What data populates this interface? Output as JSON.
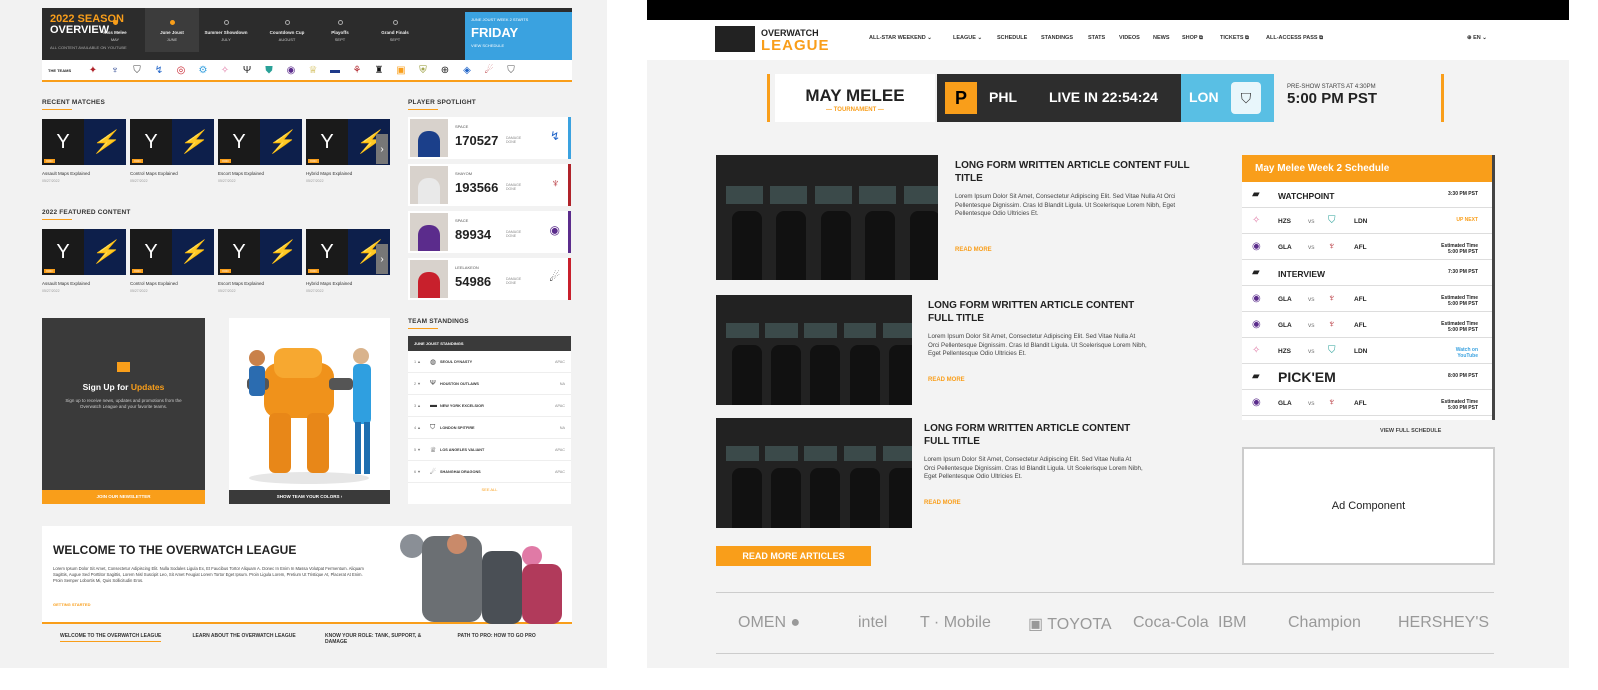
{
  "season": {
    "title_line1": "2022 SEASON",
    "title_line2": "OVERVIEW",
    "subline": "ALL CONTENT AVAILABLE ON YOUTUBE",
    "steps": [
      {
        "name": "Kiss Melee",
        "sub": "MAY"
      },
      {
        "name": "June Joust",
        "sub": "JUNE"
      },
      {
        "name": "Summer Showdown",
        "sub": "JULY"
      },
      {
        "name": "Countdown Cup",
        "sub": "AUGUST"
      },
      {
        "name": "Playoffs",
        "sub": "SEPT"
      },
      {
        "name": "Grand Finals",
        "sub": "SEPT"
      }
    ],
    "next": {
      "label": "JUNE JOUST WEEK 2 STARTS",
      "day": "FRIDAY",
      "link": "VIEW SCHEDULE"
    }
  },
  "teams_label": "THE TEAMS",
  "teams": [
    "✦",
    "♆",
    "⛉",
    "↯",
    "◎",
    "⚙",
    "✧",
    "Ψ",
    "⛊",
    "◉",
    "♕",
    "▬",
    "⚘",
    "♜",
    "▣",
    "⛨",
    "⊕",
    "◈",
    "☄",
    "⛉"
  ],
  "recent": {
    "heading": "RECENT MATCHES",
    "items": [
      {
        "title": "Assault Maps Explained",
        "meta": "05/27/2022"
      },
      {
        "title": "Control Maps Explained",
        "meta": "05/27/2022"
      },
      {
        "title": "Escort Maps Explained",
        "meta": "05/27/2022"
      },
      {
        "title": "Hybrid Maps Explained",
        "meta": "05/27/2022"
      }
    ]
  },
  "featured": {
    "heading": "2022 FEATURED CONTENT",
    "items": [
      {
        "title": "Assault Maps Explained",
        "meta": "05/27/2022"
      },
      {
        "title": "Control Maps Explained",
        "meta": "05/27/2022"
      },
      {
        "title": "Escort Maps Explained",
        "meta": "05/27/2022"
      },
      {
        "title": "Hybrid Maps Explained",
        "meta": "05/27/2022"
      }
    ]
  },
  "spotlight": {
    "heading": "PLAYER SPOTLIGHT",
    "players": [
      {
        "name": "SPACE",
        "score": "170527",
        "label": "DAMAGE DONE",
        "logo": "↯",
        "color": "#1e63c8",
        "shirt": "#1b3f8a",
        "bar": "#3aa2e0"
      },
      {
        "name": "SHAYOM",
        "score": "193566",
        "label": "DAMAGE DONE",
        "logo": "♆",
        "color": "#b0232a",
        "shirt": "#e9e9e9",
        "bar": "#b0232a"
      },
      {
        "name": "SPACE",
        "score": "89934",
        "label": "DAMAGE DONE",
        "logo": "◉",
        "color": "#5b2c8c",
        "shirt": "#5b2c8c",
        "bar": "#5b2c8c"
      },
      {
        "name": "LEELAKEON",
        "score": "54986",
        "label": "DAMAGE DONE",
        "logo": "☄",
        "color": "#222222",
        "shirt": "#c8202c",
        "bar": "#c8202c"
      }
    ]
  },
  "signup": {
    "title_a": "Sign Up for ",
    "title_b": "Updates",
    "text": "Sign up to receive news, updates and promotions from the Overwatch League and your favorite teams.",
    "button": "JOIN OUR NEWSLETTER"
  },
  "hero": {
    "button": "SHOW TEAM YOUR COLORS  ›"
  },
  "standings": {
    "heading": "TEAM STANDINGS",
    "subheading": "JUNE JOUST STANDINGS",
    "rows": [
      {
        "rank": "1 ▲",
        "icon": "◍",
        "team": "SEOUL DYNASTY",
        "conf": "APAC"
      },
      {
        "rank": "2 ▼",
        "icon": "Ψ",
        "team": "HOUSTON OUTLAWS",
        "conf": "NA"
      },
      {
        "rank": "3 ▲",
        "icon": "▬",
        "team": "NEW YORK EXCELSIOR",
        "conf": "APAC"
      },
      {
        "rank": "4 ▲",
        "icon": "⛉",
        "team": "LONDON SPITFIRE",
        "conf": "NA"
      },
      {
        "rank": "5 ▼",
        "icon": "♕",
        "team": "LOS ANGELES VALIANT",
        "conf": "APAC"
      },
      {
        "rank": "6 ▼",
        "icon": "☄",
        "team": "SHANGHAI DRAGONS",
        "conf": "APAC"
      }
    ],
    "see_all": "SEE ALL"
  },
  "welcome": {
    "title": "WELCOME TO THE OVERWATCH LEAGUE",
    "text": "Lorem Ipsum Dolor Sit Amet, Consectetur Adipiscing Elit. Nulla Sodales Ligula Ex, Et Faucibus Tortor Aliquam A. Donec In Enim In Massa Volutpat Fermentum. Aliquam Sagittis, Augue Sed Porttitor Sagittis, Lorem Nisl Suscipit Leo, Sit Amet Feugiat Lorem Tortor Eget Ipsum. Proin Ligula Lorem, Pretium Ut Tristique At, Placerat At Enim. Proin Semper Lobortis Mi, Quis Sollicitudin Eros.",
    "link": "GETTING STARTED",
    "links": [
      "WELCOME TO THE OVERWATCH LEAGUE",
      "LEARN ABOUT THE OVERWATCH LEAGUE",
      "KNOW YOUR ROLE: TANK, SUPPORT, & DAMAGE",
      "PATH TO PRO: HOW TO GO PRO"
    ]
  },
  "nav": {
    "logo_top": "OVERWATCH",
    "logo_bottom": "LEAGUE",
    "items": [
      "ALL-STAR WEEKEND ⌄",
      "LEAGUE ⌄",
      "SCHEDULE",
      "STANDINGS",
      "STATS",
      "VIDEOS",
      "NEWS",
      "SHOP ⧉",
      "TICKETS ⧉",
      "ALL-ACCESS PASS ⧉"
    ],
    "lang": "⊕ EN ⌄"
  },
  "ticker": {
    "event": "MAY MELEE",
    "event_sub": "— TOURNAMENT —",
    "team1": "PHL",
    "live": "LIVE IN 22:54:24",
    "team2": "LON",
    "pre_label": "PRE-SHOW STARTS AT 4:30PM",
    "time": "5:00 PM PST"
  },
  "articles": [
    {
      "title": "LONG FORM WRITTEN ARTICLE CONTENT FULL TITLE",
      "body": "Lorem Ipsum Dolor Sit Amet, Consectetur Adipiscing Elit. Sed Vitae Nulla At Orci Pellentesque Dignissim. Cras Id Blandit Ligula. Ut Scelerisque Lorem Nibh, Eget Pellentesque Odio Ultricies Et.",
      "more": "READ MORE"
    },
    {
      "title": "LONG FORM WRITTEN ARTICLE CONTENT FULL TITLE",
      "body": "Lorem Ipsum Dolor Sit Amet, Consectetur Adipiscing Elit. Sed Vitae Nulla At Orci Pellentesque Dignissim. Cras Id Blandit Ligula. Ut Scelerisque Lorem Nibh, Eget Pellentesque Odio Ultricies Et.",
      "more": "READ MORE"
    },
    {
      "title": "LONG FORM WRITTEN ARTICLE CONTENT FULL TITLE",
      "body": "Lorem Ipsum Dolor Sit Amet, Consectetur Adipiscing Elit. Sed Vitae Nulla At Orci Pellentesque Dignissim. Cras Id Blandit Ligula. Ut Scelerisque Lorem Nibh, Eget Pellentesque Odio Ultricies Et.",
      "more": "READ MORE"
    }
  ],
  "read_more_articles": "READ MORE ARTICLES",
  "schedule": {
    "title": "May Melee Week 2 Schedule",
    "rows": [
      {
        "type": "show",
        "icon": "▰",
        "name": "WATCHPOINT",
        "time": "3:30 PM PST"
      },
      {
        "type": "match",
        "i1": "✧",
        "a": "HZS",
        "vs": "vs",
        "i2": "⛉",
        "b": "LDN",
        "time": "UP NEXT",
        "cls": "up"
      },
      {
        "type": "match",
        "i1": "◉",
        "a": "GLA",
        "vs": "vs",
        "i2": "♆",
        "b": "AFL",
        "time": "Estimated Time 5:00 PM PST",
        "cls": ""
      },
      {
        "type": "show",
        "icon": "▰",
        "name": "INTERVIEW",
        "time": "7:30 PM PST"
      },
      {
        "type": "match",
        "i1": "◉",
        "a": "GLA",
        "vs": "vs",
        "i2": "♆",
        "b": "AFL",
        "time": "Estimated Time 5:00 PM PST",
        "cls": ""
      },
      {
        "type": "match",
        "i1": "◉",
        "a": "GLA",
        "vs": "vs",
        "i2": "♆",
        "b": "AFL",
        "time": "Estimated Time 5:00 PM PST",
        "cls": ""
      },
      {
        "type": "match",
        "i1": "✧",
        "a": "HZS",
        "vs": "vs",
        "i2": "⛉",
        "b": "LDN",
        "time": "Watch on YouTube",
        "cls": "bl"
      },
      {
        "type": "big",
        "icon": "▰",
        "name": "PICK'EM",
        "time": "8:00 PM PST"
      },
      {
        "type": "match",
        "i1": "◉",
        "a": "GLA",
        "vs": "vs",
        "i2": "♆",
        "b": "AFL",
        "time": "Estimated Time 5:00 PM PST",
        "cls": ""
      }
    ],
    "view_full": "VIEW FULL SCHEDULE"
  },
  "ad": "Ad Component",
  "sponsors": [
    "OMEN ●",
    "intel",
    "T · Mobile",
    "▣ TOYOTA",
    "Coca-Cola",
    "IBM",
    "Champion",
    "HERSHEY'S"
  ],
  "colors": {
    "accent": "#f99e1a",
    "blue": "#3aa2e0",
    "dark": "#2c2c2c"
  }
}
